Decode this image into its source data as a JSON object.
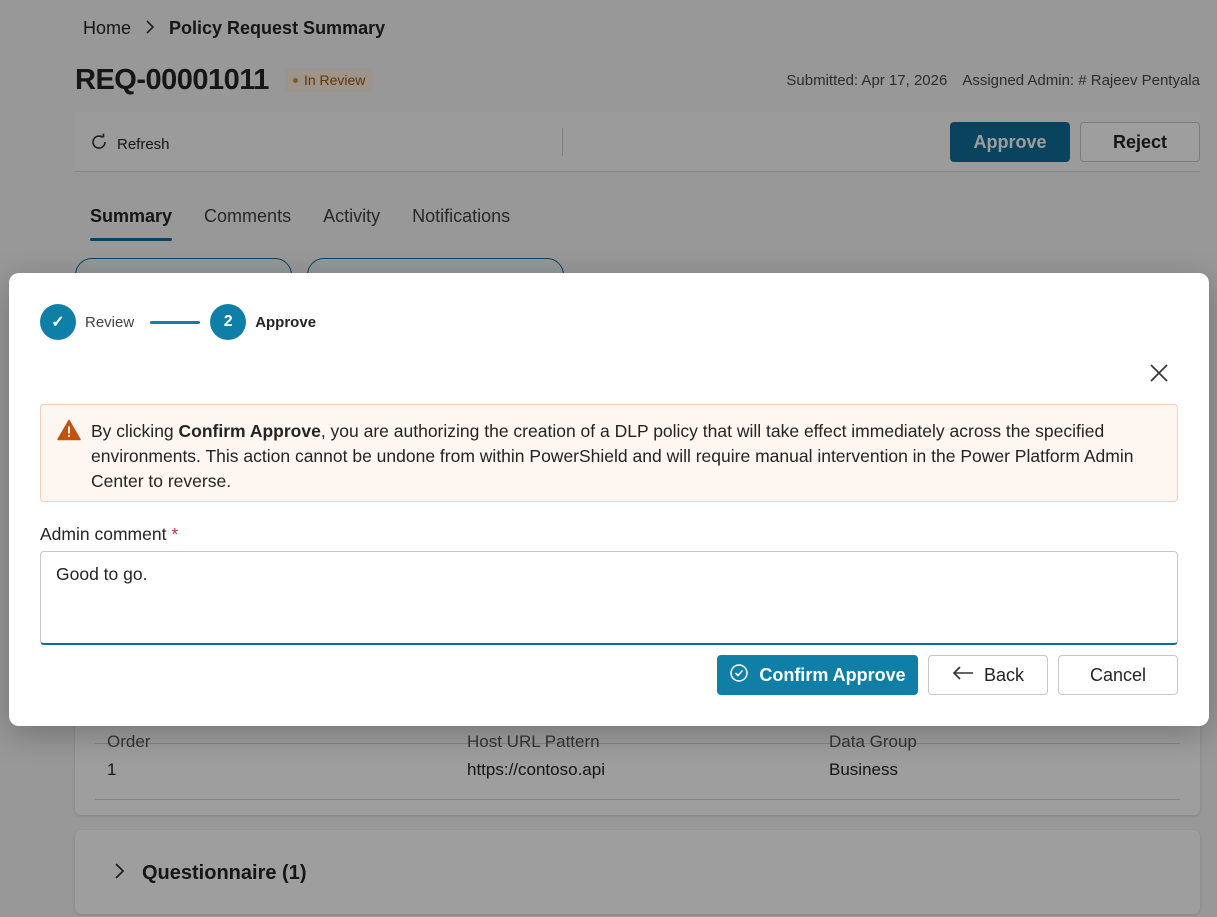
{
  "breadcrumb": {
    "home": "Home",
    "current": "Policy Request Summary"
  },
  "request": {
    "id": "REQ-00001011",
    "status": "In Review",
    "submitted": "Submitted: Apr 17, 2026",
    "assigned_admin": "Assigned Admin: # Rajeev Pentyala"
  },
  "toolbar": {
    "refresh_label": "Refresh",
    "approve_label": "Approve",
    "reject_label": "Reject"
  },
  "tabs": [
    {
      "label": "Summary",
      "active": true
    },
    {
      "label": "Comments"
    },
    {
      "label": "Activity"
    },
    {
      "label": "Notifications"
    }
  ],
  "table": {
    "headers": [
      "Order",
      "Host URL Pattern",
      "Data Group"
    ],
    "rows": [
      [
        "1",
        "https://contoso.api",
        "Business"
      ]
    ]
  },
  "questionnaire": {
    "title": "Questionnaire (1)"
  },
  "dialog": {
    "steps": [
      {
        "label": "Review",
        "state": "done",
        "marker": "✓"
      },
      {
        "label": "Approve",
        "state": "current",
        "marker": "2"
      }
    ],
    "warning": {
      "prefix": "By clicking ",
      "bold": "Confirm Approve",
      "suffix": ", you are authorizing the creation of a DLP policy that will take effect immediately across the specified environments. This action cannot be undone from within PowerShield and will require manual intervention in the Power Platform Admin Center to reverse."
    },
    "comment_label": "Admin comment",
    "required_mark": "*",
    "comment_value": "Good to go.",
    "confirm_label": "Confirm Approve",
    "back_label": "Back",
    "cancel_label": "Cancel"
  },
  "colors": {
    "accent": "#0f7fa8",
    "warning_bg": "#fdf6f1",
    "status_text": "#a2530b"
  }
}
